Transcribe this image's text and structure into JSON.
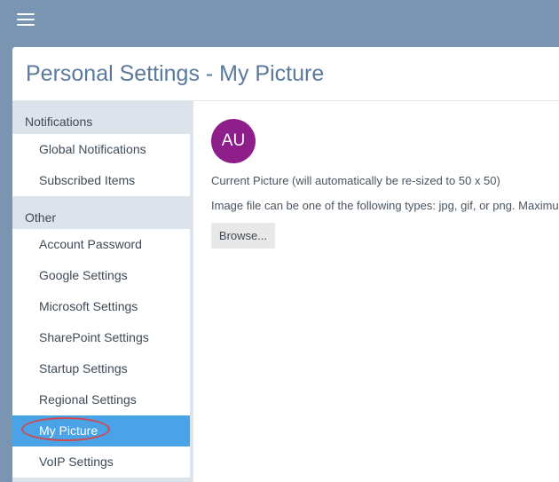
{
  "topbar": {
    "menu_icon": "hamburger-menu-icon"
  },
  "page": {
    "title": "Personal Settings - My Picture"
  },
  "sidebar": {
    "groups": [
      {
        "header": "Notifications",
        "items": [
          {
            "label": "Global Notifications"
          },
          {
            "label": "Subscribed Items"
          }
        ]
      },
      {
        "header": "Other",
        "items": [
          {
            "label": "Account Password"
          },
          {
            "label": "Google Settings"
          },
          {
            "label": "Microsoft Settings"
          },
          {
            "label": "SharePoint Settings"
          },
          {
            "label": "Startup Settings"
          },
          {
            "label": "Regional Settings"
          },
          {
            "label": "My Picture",
            "active": true
          },
          {
            "label": "VoIP Settings"
          }
        ]
      }
    ]
  },
  "content": {
    "avatar_initials": "AU",
    "current_picture_text": "Current Picture (will automatically be re-sized to 50 x 50)",
    "file_types_text": "Image file can be one of the following types: jpg, gif, or png. Maximum",
    "browse_label": "Browse..."
  },
  "colors": {
    "topbar": "#7a95b1",
    "title": "#5b7a9b",
    "sidebar_bg": "#dde3ea",
    "active_item": "#4aa3e6",
    "avatar": "#8e1e8a",
    "highlight_oval": "#d0494e"
  }
}
